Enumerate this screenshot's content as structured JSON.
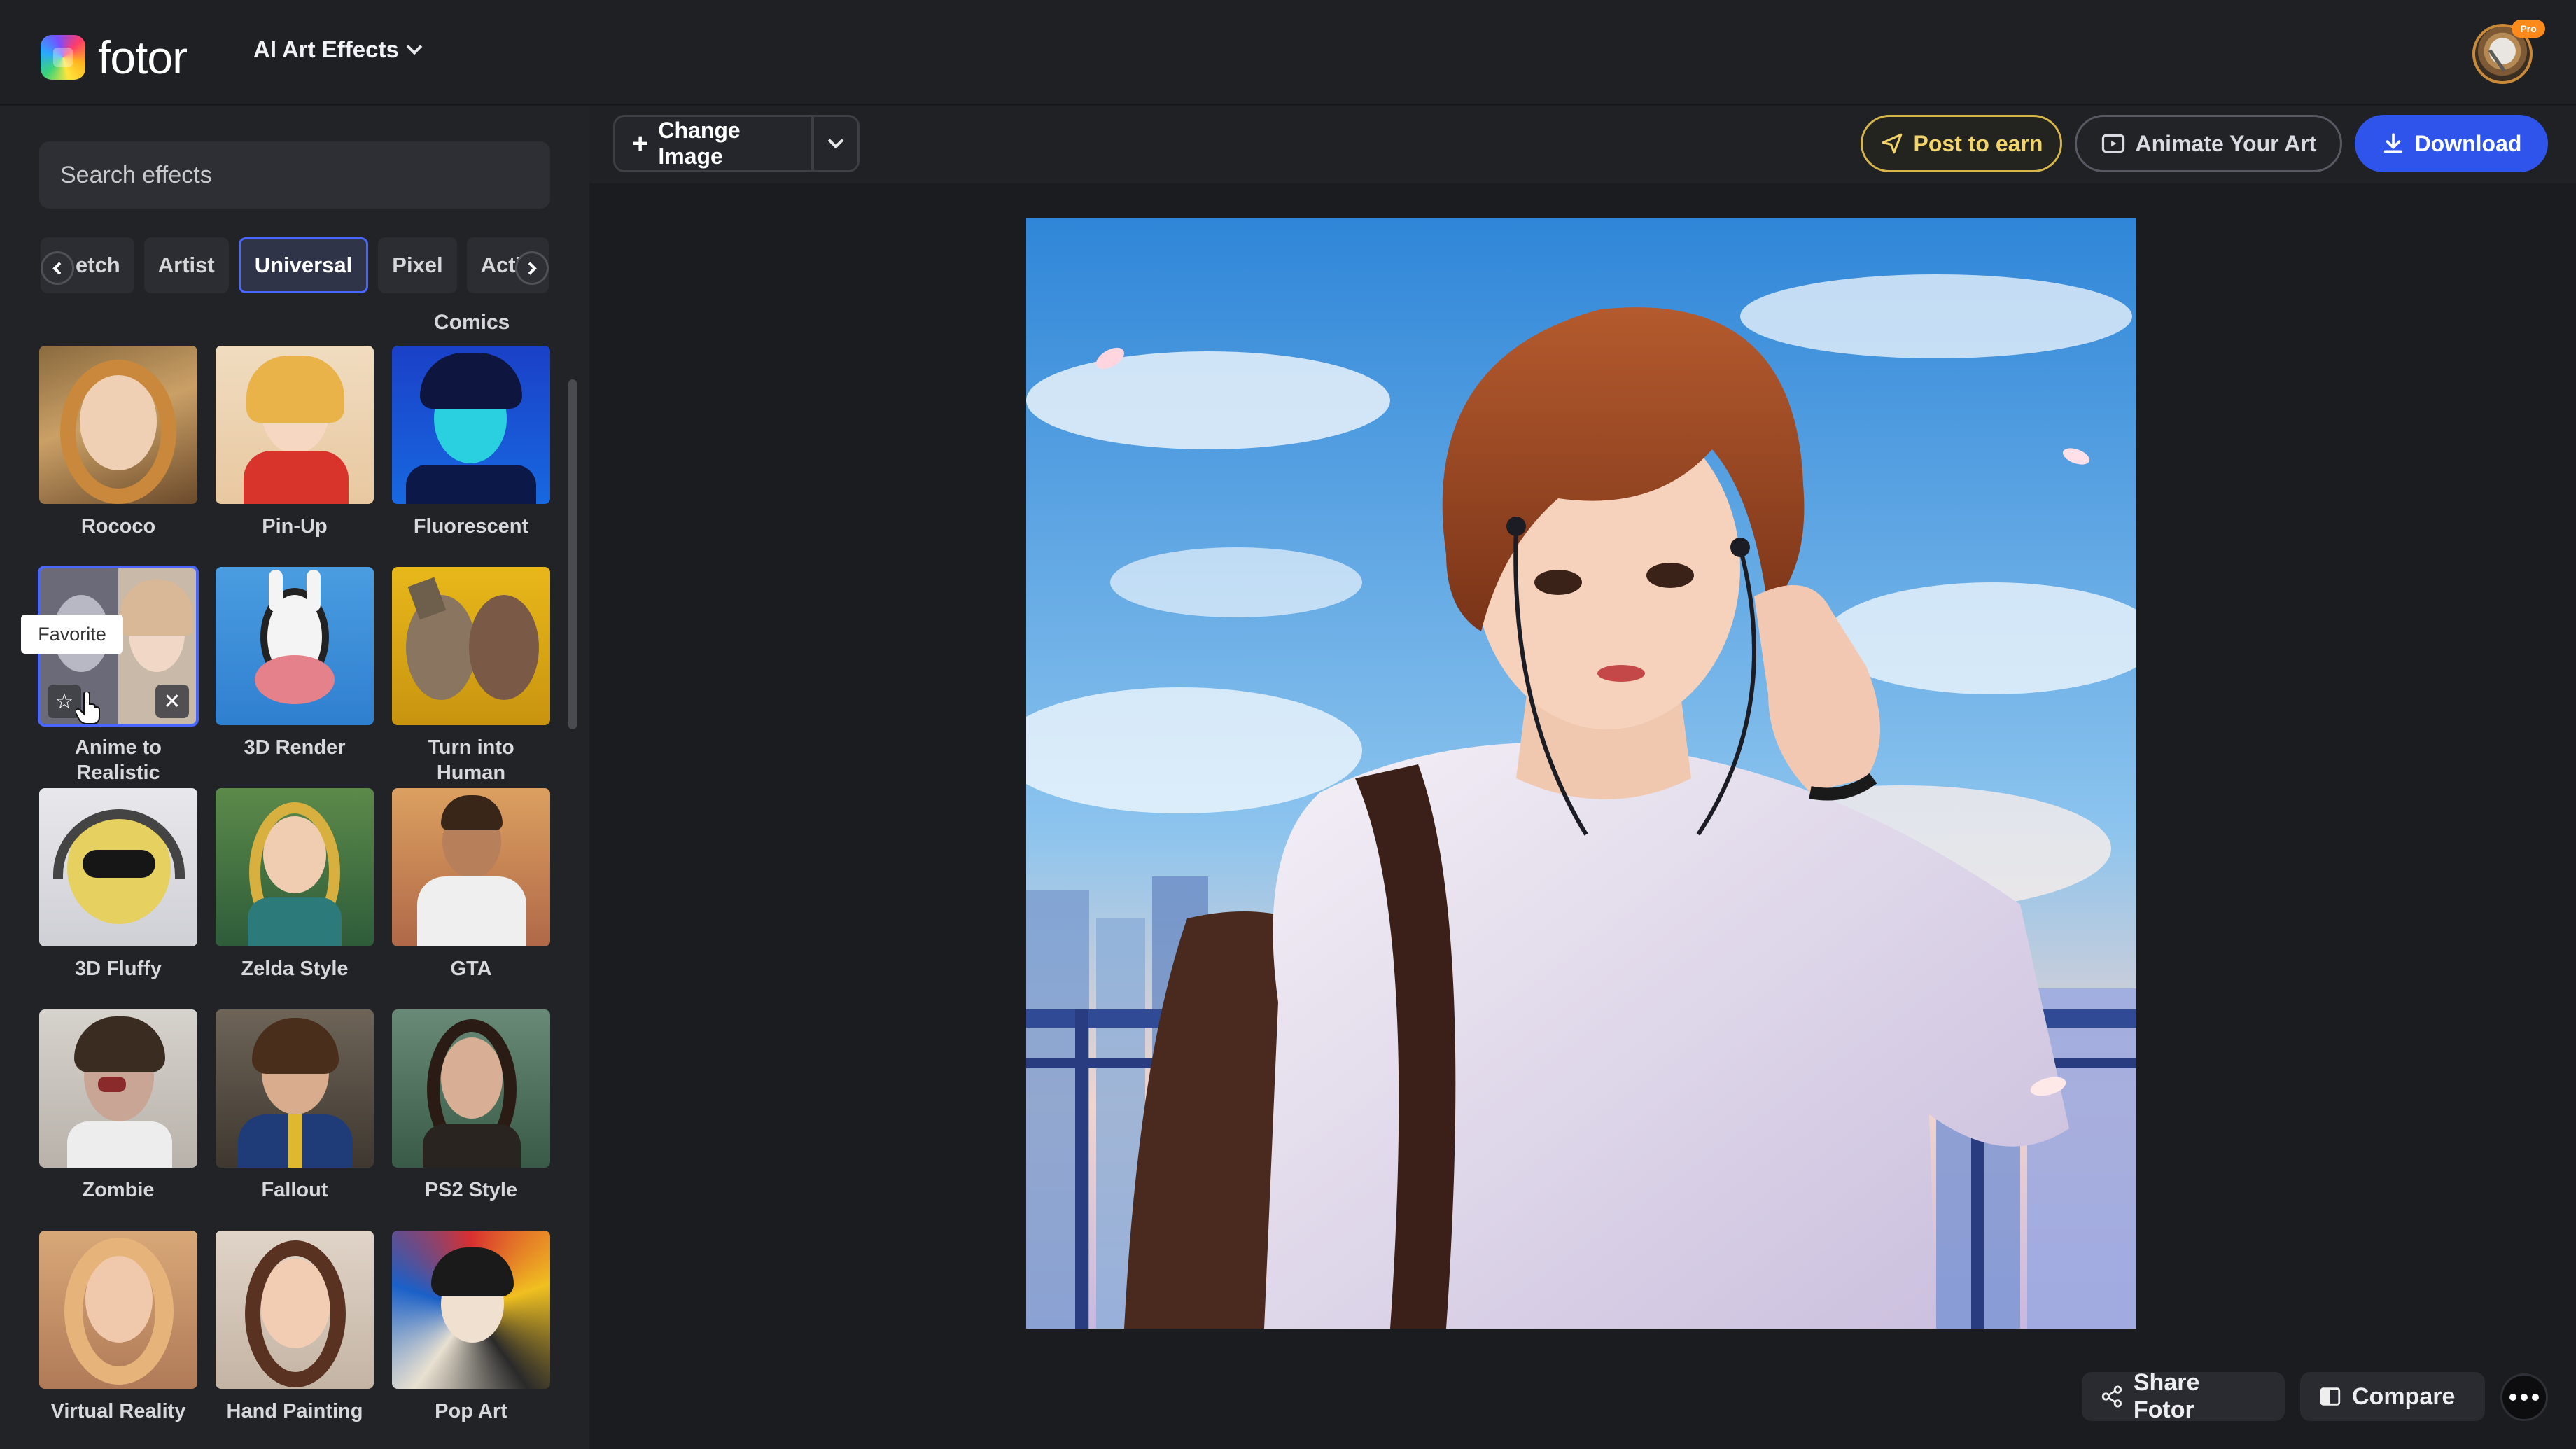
{
  "header": {
    "logo_text": "fotor",
    "menu_label": "AI Art Effects",
    "pro_badge": "Pro"
  },
  "sidebar": {
    "search_placeholder": "Search effects",
    "categories": [
      {
        "label": "etch",
        "active": false
      },
      {
        "label": "Artist",
        "active": false
      },
      {
        "label": "Universal",
        "active": true
      },
      {
        "label": "Pixel",
        "active": false
      },
      {
        "label": "Actio",
        "active": false
      }
    ],
    "comics_label": "Comics",
    "tooltip": "Favorite",
    "effects": [
      {
        "label": "Rococo"
      },
      {
        "label": "Pin-Up"
      },
      {
        "label": "Fluorescent"
      },
      {
        "label": "Anime to Realistic",
        "selected": true
      },
      {
        "label": "3D Render"
      },
      {
        "label": "Turn into Human"
      },
      {
        "label": "3D Fluffy"
      },
      {
        "label": "Zelda Style"
      },
      {
        "label": "GTA"
      },
      {
        "label": "Zombie"
      },
      {
        "label": "Fallout"
      },
      {
        "label": "PS2 Style"
      },
      {
        "label": "Virtual Reality"
      },
      {
        "label": "Hand Painting"
      },
      {
        "label": "Pop Art"
      }
    ]
  },
  "toolbar": {
    "change_image": "Change Image",
    "post_to_earn": "Post to earn",
    "animate": "Animate Your Art",
    "download": "Download"
  },
  "footer": {
    "share": "Share Fotor",
    "compare": "Compare"
  },
  "colors": {
    "accent": "#2f54eb",
    "post_gold": "#f2d46b",
    "active_outline": "#4a66ff"
  }
}
